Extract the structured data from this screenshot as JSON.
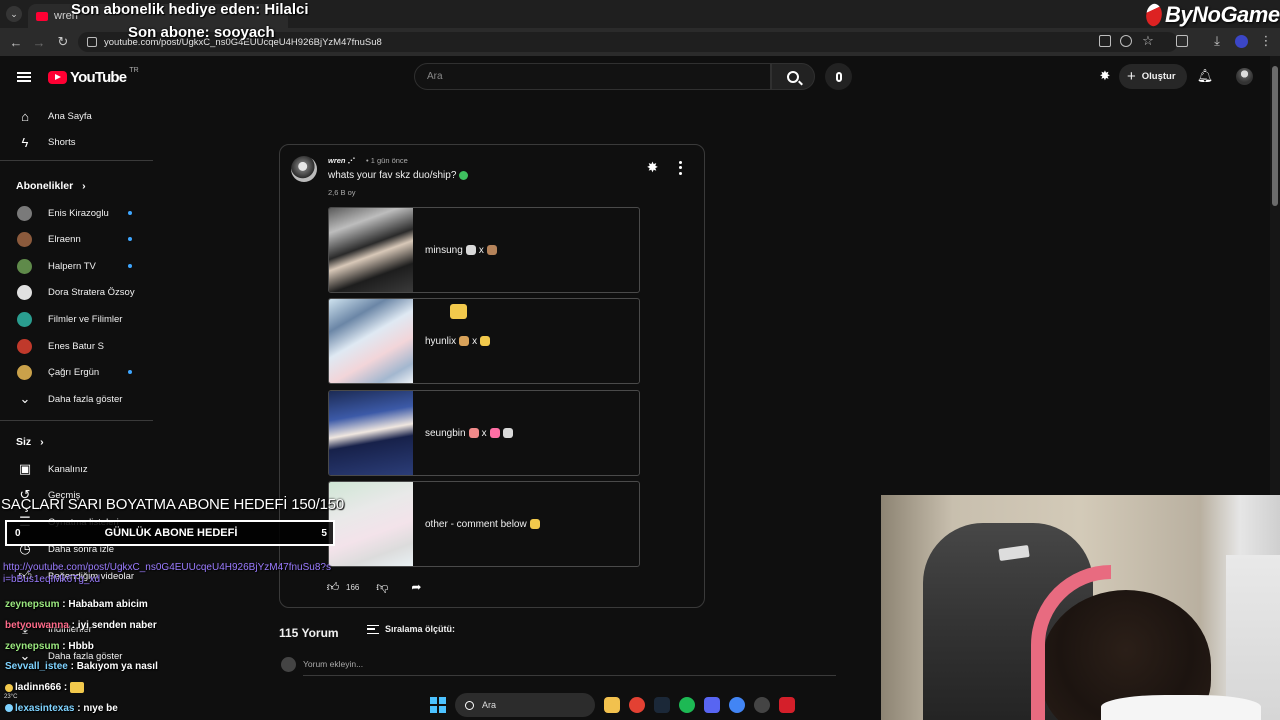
{
  "browser": {
    "tab_title": "wren",
    "url": "youtube.com/post/UgkxC_ns0G4EUUcqeU4H926BjYzM47fnuSu8"
  },
  "stream_overlay": {
    "last_gift": "Son abonelik hediye eden: Hilalci",
    "last_sub": "Son abone: sooyach",
    "brand": "ByNoGame",
    "goal_text": "SAÇLARI SARI BOYATMA ABONE HEDEFİ 150/150",
    "goal_bar": {
      "label": "GÜNLÜK ABONE HEDEFİ",
      "start": "0",
      "end": "5"
    },
    "chat_link": "http://youtube.com/post/UgkxC_ns0G4EUUcqeU4H926BjYzM47fnuSu8?si=bBus1eqIMk6Tg_xd",
    "chat": [
      {
        "user": "zeynepsum",
        "message": " : Hababam abicim"
      },
      {
        "user": "betyouwanna",
        "message": " : iyi senden naber"
      },
      {
        "user": "zeynepsum",
        "message": " : Hbbb"
      },
      {
        "user": "Sevvall_istee",
        "message": " : Bakıyom ya nasıl"
      },
      {
        "user": "ladinn666",
        "message": " : "
      },
      {
        "user": "lexasintexas",
        "message": " : nıye be"
      }
    ],
    "weather_temp": "23°C"
  },
  "youtube": {
    "logo_text": "YouTube",
    "logo_country": "TR",
    "search_placeholder": "Ara",
    "create_label": "Oluştur",
    "sidebar": {
      "top": [
        {
          "label": "Ana Sayfa",
          "icon": "home-icon"
        },
        {
          "label": "Shorts",
          "icon": "shorts-icon"
        }
      ],
      "subs_header": "Abonelikler",
      "subs": [
        {
          "label": "Enis Kirazoglu",
          "live": true,
          "color": "#7a7a7a"
        },
        {
          "label": "Elraenn",
          "live": true,
          "color": "#8b5a3c"
        },
        {
          "label": "Halpern TV",
          "live": true,
          "color": "#5f8a4a"
        },
        {
          "label": "Dora Stratera Özsoy",
          "live": false,
          "color": "#e0e0e0"
        },
        {
          "label": "Filmler ve Filimler",
          "live": false,
          "color": "#2a9d8f"
        },
        {
          "label": "Enes Batur S",
          "live": false,
          "color": "#c0392b"
        },
        {
          "label": "Çağrı Ergün",
          "live": true,
          "color": "#c9a14a"
        }
      ],
      "show_more": "Daha fazla göster",
      "you_header": "Siz",
      "you_items": [
        {
          "label": "Kanalınız"
        },
        {
          "label": "Geçmiş"
        },
        {
          "label": "Oynatma listeleri"
        },
        {
          "label": "Daha sonra izle"
        },
        {
          "label": "Beğendiğim videolar"
        },
        {
          "label": "İndirilenler"
        },
        {
          "label": "Daha fazla göster"
        }
      ]
    },
    "post": {
      "author": "wren ⋰",
      "time": "1 gün önce",
      "question": "whats your fav skz duo/ship?",
      "votes": "2,6 B oy",
      "options": [
        {
          "label": "minsung",
          "x": "x"
        },
        {
          "label": "hyunlix",
          "x": "x"
        },
        {
          "label": "seungbin",
          "x": "x"
        },
        {
          "label": "other - comment below"
        }
      ],
      "likes": "166"
    },
    "comments": {
      "count_label": "115 Yorum",
      "sort_label": "Sıralama ölçütü:",
      "input_placeholder": "Yorum ekleyin..."
    }
  },
  "taskbar": {
    "search_label": "Ara"
  }
}
